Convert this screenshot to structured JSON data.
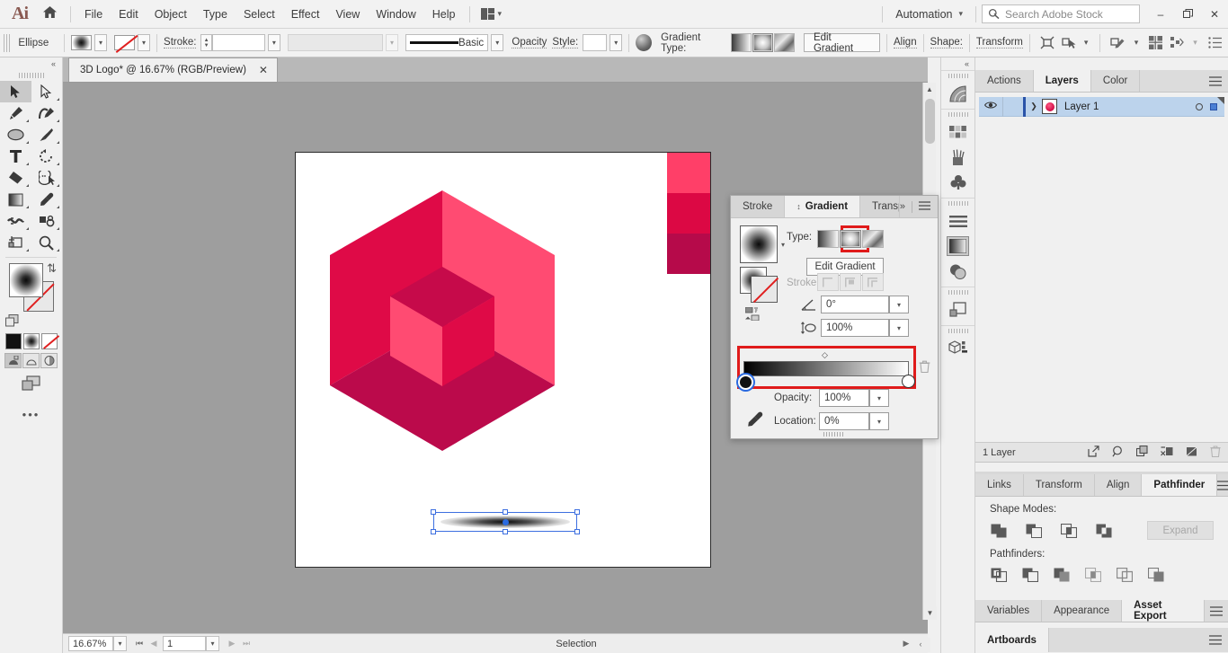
{
  "app": {
    "logo": "Ai",
    "home_icon": "home-icon",
    "menus": [
      "File",
      "Edit",
      "Object",
      "Type",
      "Select",
      "Effect",
      "View",
      "Window",
      "Help"
    ],
    "arrange_label": "arrange-documents-icon",
    "automation_label": "Automation",
    "search_placeholder": "Search Adobe Stock",
    "window_buttons": {
      "minimize": "–",
      "maximize": "❐",
      "close": "✕"
    }
  },
  "control_bar": {
    "object_label": "Ellipse",
    "stroke_label": "Stroke:",
    "stroke_weight": "",
    "stroke_profile": "",
    "brush_label": "Basic",
    "opacity_label": "Opacity",
    "style_label": "Style:",
    "gradient_type_label": "Gradient Type:",
    "gradient_types": [
      "linear",
      "radial",
      "freeform"
    ],
    "gradient_type_selected": "radial",
    "edit_gradient_label": "Edit Gradient",
    "align_label": "Align",
    "shape_label": "Shape:",
    "transform_label": "Transform"
  },
  "toolbar": {
    "collapse": "«",
    "tools": [
      {
        "name": "selection-tool",
        "active": true
      },
      {
        "name": "direct-selection-tool",
        "active": false
      },
      {
        "name": "pen-tool",
        "active": false
      },
      {
        "name": "curvature-tool",
        "active": false
      },
      {
        "name": "ellipse-tool",
        "active": false
      },
      {
        "name": "paintbrush-tool",
        "active": false
      },
      {
        "name": "type-tool",
        "active": false
      },
      {
        "name": "rotate-tool",
        "active": false
      },
      {
        "name": "eraser-tool",
        "active": false
      },
      {
        "name": "shape-builder-tool",
        "active": false
      },
      {
        "name": "gradient-tool",
        "active": false
      },
      {
        "name": "eyedropper-tool",
        "active": false
      },
      {
        "name": "width-tool",
        "active": false
      },
      {
        "name": "free-transform-tool",
        "active": false
      },
      {
        "name": "artboard-tool",
        "active": false
      },
      {
        "name": "zoom-tool",
        "active": false
      }
    ],
    "more_tools": "•••"
  },
  "document": {
    "tab_title": "3D Logo* @ 16.67% (RGB/Preview)",
    "close_icon": "✕"
  },
  "artwork": {
    "swatches": [
      "#FF3F68",
      "#DC0844",
      "#B60A4A"
    ],
    "logo_colors": {
      "light": "#FF4B72",
      "mid": "#DF0A47",
      "dark": "#BB0A4B",
      "inner_top": "#C60A4A",
      "inner_left": "#FF4B72",
      "inner_right": "#DF0A47"
    },
    "shadow_object": "radial-gradient-ellipse"
  },
  "gradient_panel": {
    "tabs": [
      "Stroke",
      "Gradient",
      "Transparen"
    ],
    "active_tab": "Gradient",
    "type_label": "Type:",
    "type_options": [
      "linear",
      "radial",
      "freeform"
    ],
    "type_selected": "radial",
    "edit_gradient_button": "Edit Gradient",
    "stroke_label": "Stroke:",
    "angle_value": "0°",
    "aspect_value": "100%",
    "opacity_label": "Opacity:",
    "opacity_value": "100%",
    "location_label": "Location:",
    "location_value": "0%",
    "delete_stop_icon": "trash-icon",
    "eyedropper_icon": "eyedropper-icon",
    "highlight_color": "#E01B1B",
    "slider_stops": [
      {
        "location": 0,
        "color": "#000000",
        "selected": true
      },
      {
        "location": 100,
        "color": "#FFFFFF",
        "selected": false
      }
    ],
    "midpoint": 50
  },
  "icon_dock": {
    "collapse": "«",
    "groups": [
      [
        "gradient-mesh-icon"
      ],
      [
        "swatches-icon",
        "brushes-icon",
        "symbols-icon"
      ],
      [
        "align-lines-icon",
        "gradient-panel-icon",
        "transparency-icon"
      ],
      [
        "artboards-icon"
      ],
      [
        "3d-materials-icon"
      ]
    ],
    "selected": "gradient-panel-icon"
  },
  "layers_panel": {
    "tabs": [
      "Actions",
      "Layers",
      "Color"
    ],
    "active_tab": "Layers",
    "layers": [
      {
        "name": "Layer 1",
        "visible": true,
        "selected": true,
        "expanded": false
      }
    ],
    "footer_count": "1 Layer",
    "footer_icons": [
      "locate-object-icon",
      "find-icon",
      "new-sublayer-icon",
      "release-icon",
      "new-layer-icon",
      "delete-icon"
    ]
  },
  "pathfinder_panel": {
    "tabs": [
      "Links",
      "Transform",
      "Align",
      "Pathfinder"
    ],
    "active_tab": "Pathfinder",
    "shape_modes_label": "Shape Modes:",
    "shape_modes": [
      "unite-icon",
      "minus-front-icon",
      "intersect-icon",
      "exclude-icon"
    ],
    "expand_label": "Expand",
    "pathfinders_label": "Pathfinders:",
    "pathfinders": [
      "divide-icon",
      "trim-icon",
      "merge-icon",
      "crop-icon",
      "outline-icon",
      "minus-back-icon"
    ]
  },
  "asset_export_panel": {
    "tabs": [
      "Variables",
      "Appearance",
      "Asset Export"
    ],
    "active_tab": "Asset Export"
  },
  "artboards_panel": {
    "tabs": [
      "Artboards"
    ],
    "active_tab": "Artboards"
  },
  "status_bar": {
    "zoom_value": "16.67%",
    "artboard_number": "1",
    "status_text": "Selection",
    "nav_first": "⏮",
    "nav_prev": "◀",
    "nav_next": "▶",
    "nav_last": "⏭"
  }
}
